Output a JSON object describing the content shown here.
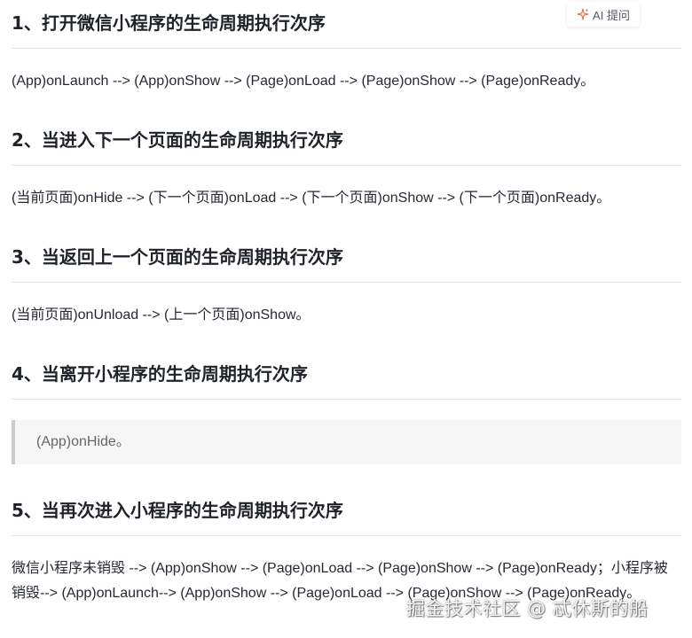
{
  "ai_button": {
    "label": "AI 提问",
    "icon": "sparkle-icon"
  },
  "sections": [
    {
      "heading": "1、打开微信小程序的生命周期执行次序",
      "paragraph": "(App)onLaunch --> (App)onShow --> (Page)onLoad --> (Page)onShow --> (Page)onReady。"
    },
    {
      "heading": "2、当进入下一个页面的生命周期执行次序",
      "paragraph": "(当前页面)onHide --> (下一个页面)onLoad --> (下一个页面)onShow --> (下一个页面)onReady。"
    },
    {
      "heading": "3、当返回上一个页面的生命周期执行次序",
      "paragraph": "(当前页面)onUnload --> (上一个页面)onShow。"
    },
    {
      "heading": "4、当离开小程序的生命周期执行次序",
      "quote": "(App)onHide。"
    },
    {
      "heading": "5、当再次进入小程序的生命周期执行次序",
      "paragraph": "微信小程序未销毁 --> (App)onShow --> (Page)onLoad --> (Page)onShow --> (Page)onReady；小程序被销毁--> (App)onLaunch--> (App)onShow --> (Page)onLoad --> (Page)onShow --> (Page)onReady。"
    }
  ],
  "watermark": "掘金技术社区 @ 忒休斯的船"
}
